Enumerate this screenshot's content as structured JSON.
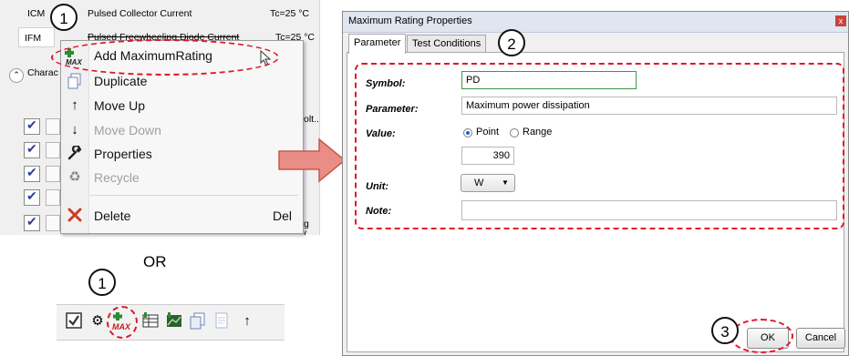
{
  "grid": {
    "row1": {
      "code": "ICM",
      "name": "Pulsed Collector Current",
      "cond": "Tc=25 °C"
    },
    "row2": {
      "code": "IFM",
      "name": "Pulsed Freewheeling Diode Current",
      "cond": "Tc=25 °C"
    },
    "section_label": "Charac",
    "partial_texts": [
      "olt...",
      "g (..."
    ]
  },
  "context_menu": {
    "items": [
      {
        "label": "Add MaximumRating",
        "icon": "add-max-icon"
      },
      {
        "label": "Duplicate",
        "icon": "duplicate-icon"
      },
      {
        "label": "Move Up",
        "icon": "arrow-up-icon"
      },
      {
        "label": "Move Down",
        "icon": "arrow-down-icon",
        "disabled": true
      },
      {
        "label": "Properties",
        "icon": "wrench-icon"
      },
      {
        "label": "Recycle",
        "icon": "recycle-icon",
        "disabled": true
      },
      {
        "label": "Delete",
        "icon": "delete-x-icon",
        "shortcut": "Del"
      }
    ]
  },
  "or_text": "OR",
  "toolbar": {
    "icons": [
      "checkbox-icon",
      "gear-icon",
      "add-max-icon",
      "table-add-icon",
      "chart-add-icon",
      "copy-icon",
      "page-icon",
      "more-icon"
    ],
    "max_label": "MAX"
  },
  "callouts": {
    "one": "1",
    "two": "2",
    "three": "3"
  },
  "dialog": {
    "title": "Maximum Rating Properties",
    "close": "x",
    "tabs": [
      "Parameter",
      "Test Conditions"
    ],
    "active_tab": "Parameter",
    "labels": {
      "symbol": "Symbol:",
      "parameter": "Parameter:",
      "value": "Value:",
      "unit": "Unit:",
      "note": "Note:"
    },
    "symbol_value": "PD",
    "parameter_value": "Maximum power dissipation",
    "value_mode": {
      "point": "Point",
      "range": "Range",
      "selected": "Point"
    },
    "value_number": "390",
    "unit_value": "W",
    "note_value": "",
    "ok_label": "OK",
    "cancel_label": "Cancel"
  },
  "colors": {
    "highlight_red": "#e0162b",
    "arrow_fill": "#e98d86"
  }
}
